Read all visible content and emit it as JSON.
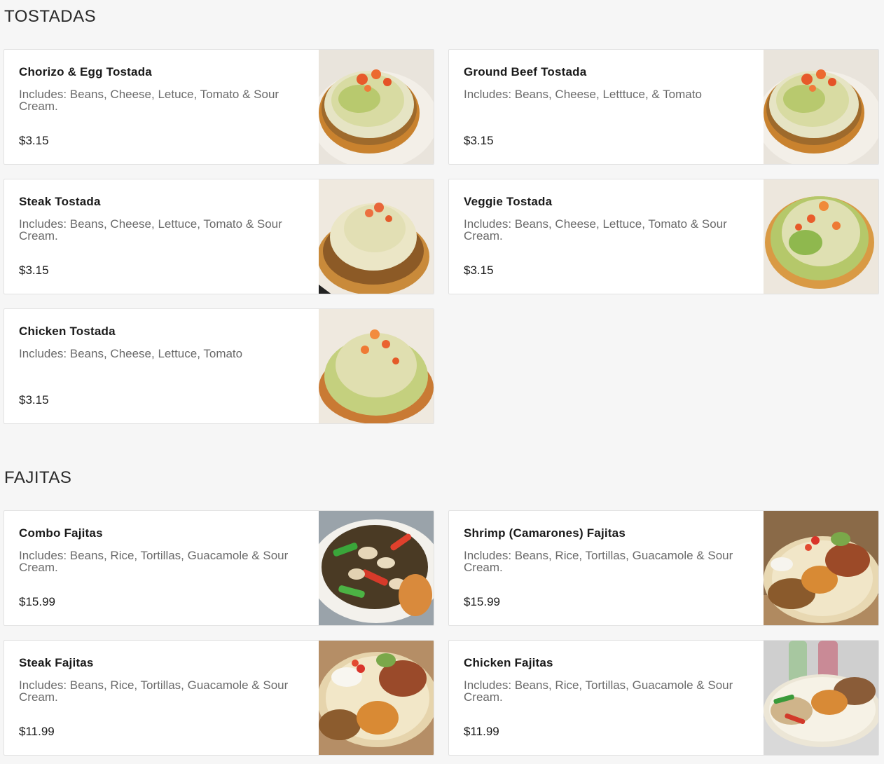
{
  "sections": [
    {
      "title": "TOSTADAS",
      "items": [
        {
          "name": "Chorizo & Egg Tostada",
          "description": "Includes: Beans, Cheese, Letuce, Tomato & Sour Cream.",
          "price": "$3.15",
          "image_icon": "tostada-photo"
        },
        {
          "name": "Ground Beef Tostada",
          "description": "Includes: Beans, Cheese, Letttuce, & Tomato",
          "price": "$3.15",
          "image_icon": "tostada-photo"
        },
        {
          "name": "Steak Tostada",
          "description": "Includes: Beans, Cheese, Lettuce, Tomato & Sour Cream.",
          "price": "$3.15",
          "image_icon": "tostada-photo"
        },
        {
          "name": "Veggie Tostada",
          "description": "Includes: Beans, Cheese, Lettuce, Tomato & Sour Cream.",
          "price": "$3.15",
          "image_icon": "tostada-photo"
        },
        {
          "name": "Chicken Tostada",
          "description": "Includes: Beans, Cheese, Lettuce, Tomato",
          "price": "$3.15",
          "image_icon": "tostada-photo"
        }
      ]
    },
    {
      "title": "FAJITAS",
      "items": [
        {
          "name": "Combo Fajitas",
          "description": "Includes: Beans, Rice, Tortillas, Guacamole & Sour Cream.",
          "price": "$15.99",
          "image_icon": "fajitas-photo"
        },
        {
          "name": "Shrimp (Camarones) Fajitas",
          "description": "Includes: Beans, Rice, Tortillas, Guacamole & Sour Cream.",
          "price": "$15.99",
          "image_icon": "fajitas-plate-photo"
        },
        {
          "name": "Steak Fajitas",
          "description": "Includes: Beans, Rice, Tortillas, Guacamole & Sour Cream.",
          "price": "$11.99",
          "image_icon": "fajitas-plate-photo"
        },
        {
          "name": "Chicken Fajitas",
          "description": "Includes: Beans, Rice, Tortillas, Guacamole & Sour Cream.",
          "price": "$11.99",
          "image_icon": "fajitas-plate-photo"
        }
      ]
    }
  ],
  "colors": {
    "background": "#f6f6f6",
    "card": "#ffffff",
    "border": "#e2e2e2",
    "description": "#6a6a6a"
  }
}
